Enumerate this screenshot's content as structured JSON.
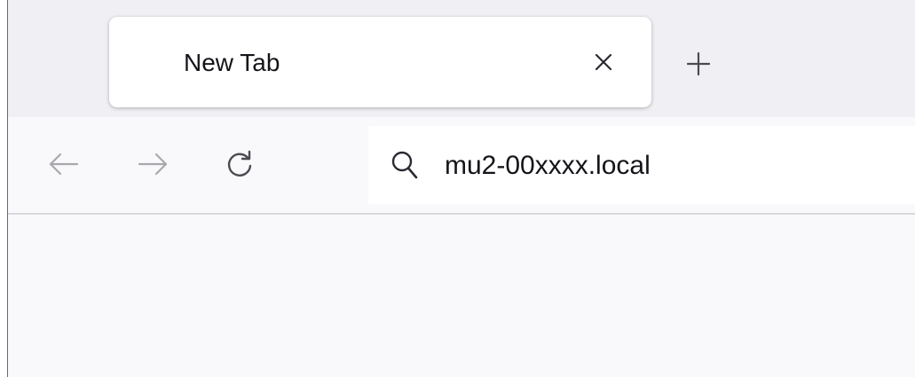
{
  "tabs": [
    {
      "title": "New Tab",
      "close_icon": "close-icon"
    }
  ],
  "tabstrip": {
    "new_tab_icon": "plus-icon"
  },
  "navigation": {
    "back_icon": "arrow-left-icon",
    "forward_icon": "arrow-right-icon",
    "reload_icon": "reload-icon"
  },
  "urlbar": {
    "icon": "search-icon",
    "value": "mu2-00xxxx.local"
  },
  "colors": {
    "tabstrip_bg": "#f0f0f4",
    "toolbar_bg": "#f9f9fb",
    "icon_muted": "#a8a8ae",
    "icon_active": "#4a4a52",
    "text": "#15141a"
  }
}
